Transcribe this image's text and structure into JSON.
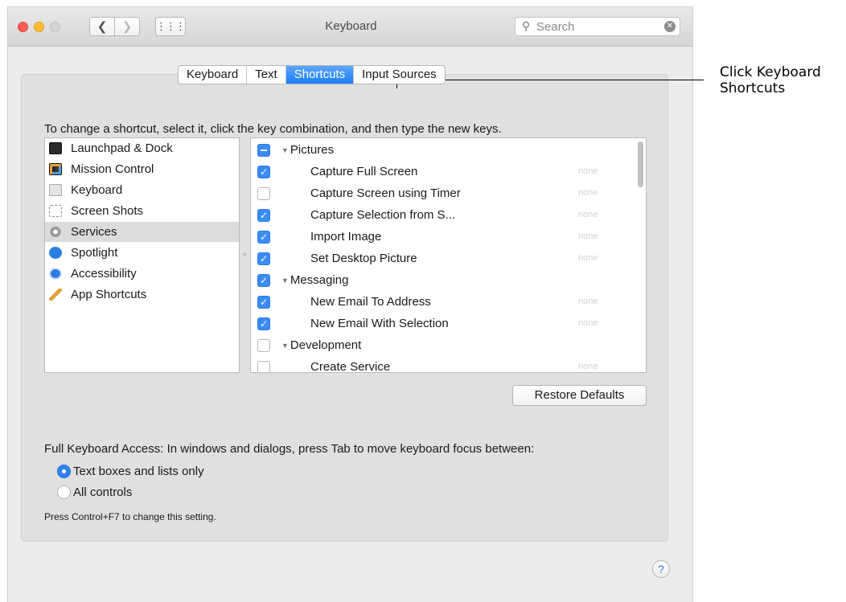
{
  "window": {
    "title": "Keyboard"
  },
  "search": {
    "placeholder": "Search"
  },
  "tabs": [
    "Keyboard",
    "Text",
    "Shortcuts",
    "Input Sources"
  ],
  "active_tab": "Shortcuts",
  "instruction": "To change a shortcut, select it, click the key combination, and then type the new keys.",
  "categories": [
    {
      "label": "Launchpad & Dock",
      "icon": "dock-icon"
    },
    {
      "label": "Mission Control",
      "icon": "mission-control-icon"
    },
    {
      "label": "Keyboard",
      "icon": "keyboard-icon"
    },
    {
      "label": "Screen Shots",
      "icon": "screenshot-icon"
    },
    {
      "label": "Services",
      "icon": "gear-icon",
      "selected": true
    },
    {
      "label": "Spotlight",
      "icon": "spotlight-icon"
    },
    {
      "label": "Accessibility",
      "icon": "accessibility-icon"
    },
    {
      "label": "App Shortcuts",
      "icon": "app-shortcuts-icon"
    }
  ],
  "shortcuts": [
    {
      "type": "group",
      "label": "Pictures",
      "check": "mixed"
    },
    {
      "type": "item",
      "label": "Capture Full Screen",
      "check": "on",
      "key": "none"
    },
    {
      "type": "item",
      "label": "Capture Screen using Timer",
      "check": "off",
      "key": "none"
    },
    {
      "type": "item",
      "label": "Capture Selection from S...",
      "check": "on",
      "key": "none"
    },
    {
      "type": "item",
      "label": "Import Image",
      "check": "on",
      "key": "none"
    },
    {
      "type": "item",
      "label": "Set Desktop Picture",
      "check": "on",
      "key": "none"
    },
    {
      "type": "group",
      "label": "Messaging",
      "check": "on"
    },
    {
      "type": "item",
      "label": "New Email To Address",
      "check": "on",
      "key": "none"
    },
    {
      "type": "item",
      "label": "New Email With Selection",
      "check": "on",
      "key": "none"
    },
    {
      "type": "group",
      "label": "Development",
      "check": "off"
    },
    {
      "type": "item",
      "label": "Create Service",
      "check": "off",
      "key": "none"
    }
  ],
  "restore_button": "Restore Defaults",
  "full_keyboard_access": {
    "label": "Full Keyboard Access: In windows and dialogs, press Tab to move keyboard focus between:",
    "options": [
      {
        "label": "Text boxes and lists only",
        "selected": true
      },
      {
        "label": "All controls",
        "selected": false
      }
    ],
    "note": "Press Control+F7 to change this setting."
  },
  "help_button": "?",
  "callout": {
    "lines": [
      "Click Keyboard",
      "Shortcuts"
    ]
  },
  "colors": {
    "accent": "#1b7ef6",
    "checkbox": "#3b8cf7"
  }
}
